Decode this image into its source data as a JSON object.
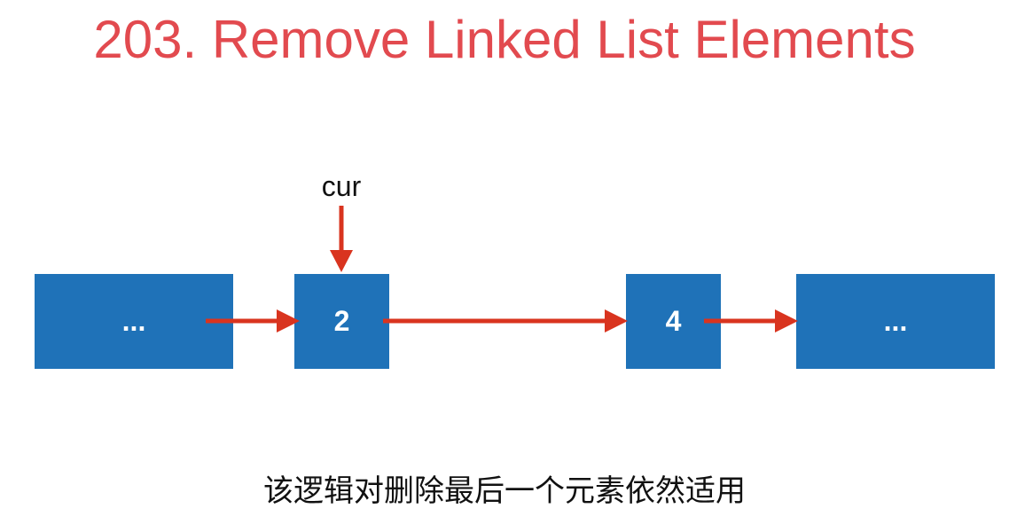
{
  "title": "203. Remove Linked List Elements",
  "nodes": [
    {
      "label": "..."
    },
    {
      "label": "2"
    },
    {
      "label": "4"
    },
    {
      "label": "..."
    }
  ],
  "pointer": {
    "label": "cur",
    "target_node_index": 1
  },
  "links": [
    {
      "from": 0,
      "to": 1
    },
    {
      "from": 1,
      "to": 2
    },
    {
      "from": 2,
      "to": 3
    }
  ],
  "caption": "该逻辑对删除最后一个元素依然适用",
  "colors": {
    "title": "#e24a4f",
    "node_fill": "#1f72b8",
    "node_text": "#ffffff",
    "arrow": "#d9341f",
    "text": "#111111",
    "background": "#ffffff"
  }
}
